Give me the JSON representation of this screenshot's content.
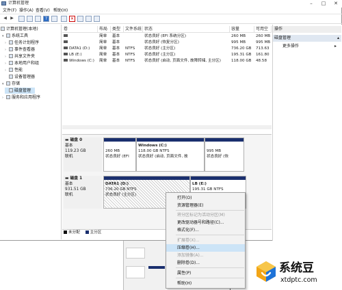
{
  "window": {
    "title": "计算机管理"
  },
  "menubar": {
    "items": [
      "文件(F)",
      "操作(A)",
      "查看(V)",
      "帮助(H)"
    ]
  },
  "tree": {
    "items": [
      {
        "label": "计算机管理(本地)",
        "level": 0
      },
      {
        "label": "系统工具",
        "level": 1
      },
      {
        "label": "任务计划程序",
        "level": 2
      },
      {
        "label": "事件查看器",
        "level": 2
      },
      {
        "label": "共享文件夹",
        "level": 2
      },
      {
        "label": "本地用户和组",
        "level": 2
      },
      {
        "label": "性能",
        "level": 2
      },
      {
        "label": "设备管理器",
        "level": 2
      },
      {
        "label": "存储",
        "level": 1
      },
      {
        "label": "磁盘管理",
        "level": 2
      },
      {
        "label": "服务和应用程序",
        "level": 1
      }
    ]
  },
  "volumes": {
    "columns": [
      "卷",
      "布局",
      "类型",
      "文件系统",
      "状态",
      "容量",
      "可用空"
    ],
    "rows": [
      [
        "",
        "简单",
        "基本",
        "",
        "状态良好 (EFI 系统分区)",
        "260 MB",
        "260 MB"
      ],
      [
        "",
        "简单",
        "基本",
        "",
        "状态良好 (恢复分区)",
        "995 MB",
        "995 MB"
      ],
      [
        "DATA1 (D:)",
        "简单",
        "基本",
        "NTFS",
        "状态良好 (主分区)",
        "736.20 GB",
        "713.63"
      ],
      [
        "LB (E:)",
        "简单",
        "基本",
        "NTFS",
        "状态良好 (主分区)",
        "195.31 GB",
        "161.80"
      ],
      [
        "Windows (C:)",
        "简单",
        "基本",
        "NTFS",
        "状态良好 (启动, 页面文件, 故障转储, 主分区)",
        "118.00 GB",
        "48.58"
      ]
    ]
  },
  "disks": [
    {
      "name": "磁盘 0",
      "type": "基本",
      "size": "119.23 GB",
      "status": "联机",
      "partitions": [
        {
          "title": "",
          "line1": "260 MB",
          "line2": "状态良好 (EFI"
        },
        {
          "title": "Windows  (C:)",
          "line1": "118.00 GB NTFS",
          "line2": "状态良好 (启动, 页面文件, 故"
        },
        {
          "title": "",
          "line1": "995 MB",
          "line2": "状态良好 (恢"
        }
      ]
    },
    {
      "name": "磁盘 1",
      "type": "基本",
      "size": "931.51 GB",
      "status": "联机",
      "partitions": [
        {
          "title": "DATA1  (D:)",
          "line1": "736.20 GB NTFS",
          "line2": "状态良好 (主分区)"
        },
        {
          "title": "LB  (E:)",
          "line1": "195.31 GB NTFS",
          "line2": ""
        }
      ]
    }
  ],
  "legend": {
    "unallocated": "未分配",
    "primary": "主分区"
  },
  "actions": {
    "title": "操作",
    "section": "磁盘管理",
    "more": "更多操作"
  },
  "context_menu": {
    "items": [
      {
        "label": "打开(O)",
        "disabled": false
      },
      {
        "label": "资源管理器(E)",
        "disabled": false
      },
      {
        "label": "将分区标记为活动分区(M)",
        "disabled": true
      },
      {
        "label": "更改驱动器号和路径(C)...",
        "disabled": false
      },
      {
        "label": "格式化(F)...",
        "disabled": false
      },
      {
        "label": "扩展卷(X)...",
        "disabled": true
      },
      {
        "label": "压缩卷(H)...",
        "disabled": false,
        "highlighted": true
      },
      {
        "label": "添加镜像(A)...",
        "disabled": true
      },
      {
        "label": "删除卷(D)...",
        "disabled": false
      },
      {
        "label": "属性(P)",
        "disabled": false
      },
      {
        "label": "帮助(H)",
        "disabled": false
      }
    ]
  },
  "watermark": {
    "brand": "系统豆",
    "url": "xtdptc.com"
  },
  "colors": {
    "primary_partition": "#1a2f6e",
    "unallocated": "#111111",
    "selection": "#cce4f7"
  },
  "icons": [
    "computer-management-icon",
    "minimize-icon",
    "maximize-icon",
    "close-icon",
    "back-icon",
    "forward-icon",
    "help-icon",
    "disk-icon",
    "brand-logo-icon"
  ]
}
